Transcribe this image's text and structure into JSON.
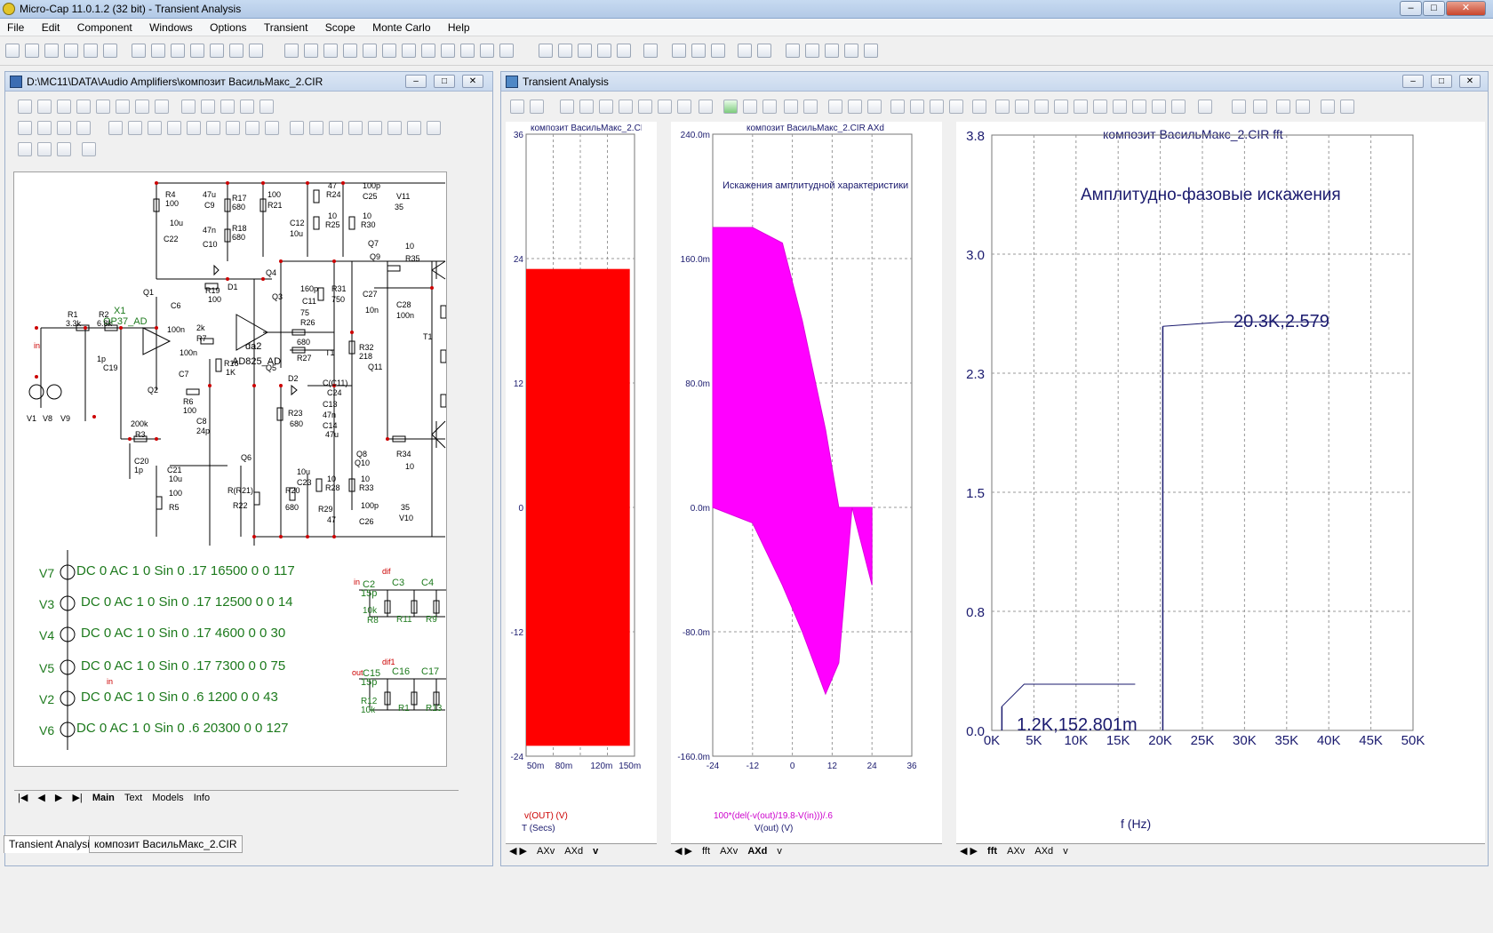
{
  "app": {
    "title": "Micro-Cap 11.0.1.2 (32 bit) - Transient Analysis"
  },
  "menu": [
    "File",
    "Edit",
    "Component",
    "Windows",
    "Options",
    "Transient",
    "Scope",
    "Monte Carlo",
    "Help"
  ],
  "schematic": {
    "title": "D:\\MC11\\DATA\\Audio Amplifiers\\композит ВасильМакс_2.CIR",
    "sources": [
      {
        "name": "V7",
        "text": "DC 0 AC 1 0 Sin 0 .17 16500 0 0 117"
      },
      {
        "name": "V3",
        "text": "DC 0 AC 1 0 Sin 0 .17 12500 0 0 14"
      },
      {
        "name": "V4",
        "text": "DC 0 AC 1 0 Sin 0 .17 4600 0 0 30"
      },
      {
        "name": "V5",
        "text": "DC 0 AC 1 0 Sin 0 .17 7300 0 0 75"
      },
      {
        "name": "V2",
        "text": "DC 0 AC 1 0 Sin 0 .6 1200 0 0 43"
      },
      {
        "name": "V6",
        "text": "DC 0 AC 1 0 Sin 0 .6 20300 0 0 127"
      }
    ],
    "labels": {
      "x1": "X1",
      "op37": "OP37_AD",
      "ad825": "AD825_AD",
      "da2": "da2",
      "r1": "R1",
      "r1v": "3.3k",
      "r2": "R2",
      "r2v": "6.8k",
      "c19": "C19",
      "c19v": "1p",
      "r3": "R3",
      "r3v": "200k",
      "c20": "C20",
      "c20v": "1p",
      "q1": "Q1",
      "q2": "Q2",
      "c6": "C6",
      "c6v": "100n",
      "c7": "C7",
      "r7": "R7",
      "r7v": "2k",
      "r6": "R6",
      "r6v": "100",
      "c8": "C8",
      "c8v": "24p",
      "r4": "R4",
      "r4v": "100",
      "c22": "C22",
      "c22v": "10u",
      "r17": "R17",
      "r17v": "680",
      "r18": "R18",
      "r18v": "680",
      "c9": "C9",
      "c9v": "47u",
      "c10": "C10",
      "c10v": "47n",
      "r19": "R19",
      "r19v": "100",
      "d1": "D1",
      "r16": "R16",
      "r16v": "1K",
      "q4": "Q4",
      "q3": "Q3",
      "q5": "Q5",
      "q6": "Q6",
      "r21": "R21",
      "r21v": "100",
      "c12": "C12",
      "c12v": "10u",
      "r24": "R24",
      "r24v": "47",
      "c25": "C25",
      "c25v": "100p",
      "v11": "V11",
      "v11v": "35",
      "r25": "R25",
      "r25v": "10",
      "r30": "R30",
      "r30v": "10",
      "q7": "Q7",
      "q9": "Q9",
      "r35": "R35",
      "r35v": "10",
      "c11": "C11",
      "c11v": "160p",
      "r31": "R31",
      "r31v": "750",
      "c27": "C27",
      "c27v": "10n",
      "c28": "C28",
      "c28v": "100n",
      "r26": "R26",
      "r26v": "75",
      "r27": "R27",
      "r27v": "680",
      "t1": "T1",
      "r32": "R32",
      "r32v": "218",
      "q11": "Q11",
      "d2": "D2",
      "c24": "C24",
      "c24v": "C(C11)",
      "c13": "C13",
      "c13v": "47n",
      "c14": "C14",
      "c14v": "47u",
      "r23": "R23",
      "r23v": "680",
      "r34": "R34",
      "r34v": "10",
      "q8": "Q8",
      "q10": "Q10",
      "c21": "C21",
      "c21v": "10u",
      "r5": "R5",
      "r5v": "100",
      "rr21": "R(R21)",
      "r22": "R22",
      "r20": "R20",
      "r20v": "680",
      "c23": "C23",
      "c23v": "10u",
      "r28": "R28",
      "r28v": "10",
      "r29": "R29",
      "r29v": "47",
      "r33": "R33",
      "r33v": "10",
      "c26": "C26",
      "c26v": "100p",
      "v10": "V10",
      "v10v": "35",
      "v1": "V1",
      "v8": "V8",
      "v9": "V9",
      "in": "in",
      "in2": "in",
      "dif": "dif",
      "dif1": "dif1",
      "out": "out",
      "c2": "C2",
      "c2v": "15p",
      "c3": "C3",
      "c4": "C4",
      "r8": "R8",
      "r8v": "10k",
      "r11": "R11",
      "r9": "R9",
      "c15": "C15",
      "c15v": "15p",
      "c16": "C16",
      "c17": "C17",
      "r12": "R12",
      "r12v": "10k",
      "r1b": "R1",
      "r1x": "R13"
    },
    "tabs": [
      "Main",
      "Text",
      "Models",
      "Info"
    ]
  },
  "analysis": {
    "title": "Transient Analysis",
    "plot1": {
      "title": "композит ВасильМакс_2.CIR",
      "y_ticks": [
        "36",
        "24",
        "12",
        "0",
        "-12",
        "-24"
      ],
      "x_ticks": [
        "50m",
        "80m",
        "120m",
        "150m"
      ],
      "y_label": "v(OUT) (V)",
      "x_label": "T (Secs)",
      "tabs": [
        "AXv",
        "AXd",
        "v"
      ]
    },
    "plot2": {
      "title": "композит ВасильМакс_2.CIR AXd",
      "annotation": "Искажения амплитудной характеристики",
      "y_ticks": [
        "240.0m",
        "160.0m",
        "80.0m",
        "0.0m",
        "-80.0m",
        "-160.0m"
      ],
      "x_ticks": [
        "-24",
        "-12",
        "0",
        "12",
        "24",
        "36"
      ],
      "y_label": "100*(del(-v(out)/19.8-V(in)))/.6",
      "x_label": "V(out) (V)",
      "tabs": [
        "fft",
        "AXv",
        "AXd",
        "v"
      ]
    },
    "plot3": {
      "title": "композит ВасильМакс_2.CIR fft",
      "annotation": "Амплитудно-фазовые искажения",
      "y_ticks": [
        "3.8",
        "3.0",
        "2.3",
        "1.5",
        "0.8",
        "0.0"
      ],
      "x_ticks": [
        "0K",
        "5K",
        "10K",
        "15K",
        "20K",
        "25K",
        "30K",
        "35K",
        "40K",
        "45K",
        "50K"
      ],
      "x_label": "f (Hz)",
      "tags": [
        "20.3K,2.579",
        "1.2K,152.801m"
      ],
      "tabs": [
        "fft",
        "AXv",
        "AXd",
        "v"
      ]
    }
  },
  "chart_data": [
    {
      "type": "area",
      "title": "",
      "xlabel": "T (Secs)",
      "ylabel": "v(OUT) (V)",
      "xlim": [
        0.04,
        0.155
      ],
      "ylim": [
        -24,
        36
      ],
      "series": [
        {
          "name": "v(OUT)",
          "x": [
            0.04,
            0.15
          ],
          "ymin": -23,
          "ymax": 23
        }
      ]
    },
    {
      "type": "scatter",
      "title": "",
      "xlabel": "V(out) (V)",
      "ylabel": "100*(del(-v(out)/19.8-V(in)))/.6",
      "xlim": [
        -24,
        36
      ],
      "ylim": [
        -0.16,
        0.24
      ],
      "series": [
        {
          "name": "AXd",
          "x": [
            -24,
            -12,
            -3,
            3,
            10,
            14,
            18,
            24
          ],
          "ymin": [
            0.0,
            -0.01,
            -0.05,
            -0.08,
            -0.12,
            -0.1,
            0.0,
            -0.05
          ],
          "ymax": [
            0.18,
            0.18,
            0.17,
            0.12,
            0.05,
            0.0,
            0.0,
            0.0
          ]
        }
      ]
    },
    {
      "type": "line",
      "title": "",
      "xlabel": "f (Hz)",
      "ylabel": "",
      "xlim": [
        0,
        50000
      ],
      "ylim": [
        0,
        3.8
      ],
      "series": [
        {
          "name": "fft",
          "x": [
            1200,
            20300
          ],
          "y": [
            0.152801,
            2.579
          ]
        }
      ]
    }
  ]
}
